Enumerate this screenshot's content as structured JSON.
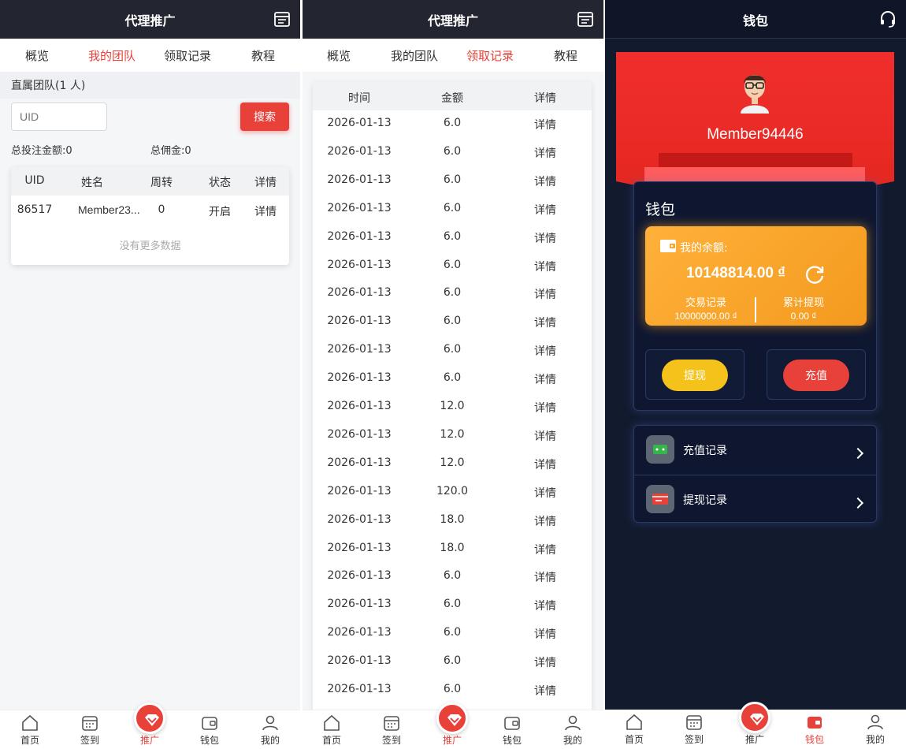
{
  "screen1": {
    "title": "代理推广",
    "tabs": [
      {
        "label": "概览",
        "active": false
      },
      {
        "label": "我的团队",
        "active": true
      },
      {
        "label": "领取记录",
        "active": false
      },
      {
        "label": "教程",
        "active": false
      }
    ],
    "team_header": "直属团队(1 人)",
    "uid_placeholder": "UID",
    "search_label": "搜索",
    "total_bet": "总投注金额:0",
    "total_commission": "总佣金:0",
    "table": {
      "headers": [
        "UID",
        "姓名",
        "周转",
        "状态",
        "详情"
      ],
      "rows": [
        [
          "86517",
          "Member23...",
          "0",
          "开启",
          "详情"
        ]
      ],
      "no_more": "没有更多数据"
    }
  },
  "screen2": {
    "title": "代理推广",
    "tabs": [
      {
        "label": "概览",
        "active": false
      },
      {
        "label": "我的团队",
        "active": false
      },
      {
        "label": "领取记录",
        "active": true
      },
      {
        "label": "教程",
        "active": false
      }
    ],
    "headers": [
      "时间",
      "金额",
      "详情"
    ],
    "rows": [
      [
        "2026-01-13",
        "6.0",
        "详情"
      ],
      [
        "2026-01-13",
        "6.0",
        "详情"
      ],
      [
        "2026-01-13",
        "6.0",
        "详情"
      ],
      [
        "2026-01-13",
        "6.0",
        "详情"
      ],
      [
        "2026-01-13",
        "6.0",
        "详情"
      ],
      [
        "2026-01-13",
        "6.0",
        "详情"
      ],
      [
        "2026-01-13",
        "6.0",
        "详情"
      ],
      [
        "2026-01-13",
        "6.0",
        "详情"
      ],
      [
        "2026-01-13",
        "6.0",
        "详情"
      ],
      [
        "2026-01-13",
        "6.0",
        "详情"
      ],
      [
        "2026-01-13",
        "12.0",
        "详情"
      ],
      [
        "2026-01-13",
        "12.0",
        "详情"
      ],
      [
        "2026-01-13",
        "12.0",
        "详情"
      ],
      [
        "2026-01-13",
        "120.0",
        "详情"
      ],
      [
        "2026-01-13",
        "18.0",
        "详情"
      ],
      [
        "2026-01-13",
        "18.0",
        "详情"
      ],
      [
        "2026-01-13",
        "6.0",
        "详情"
      ],
      [
        "2026-01-13",
        "6.0",
        "详情"
      ],
      [
        "2026-01-13",
        "6.0",
        "详情"
      ],
      [
        "2026-01-13",
        "6.0",
        "详情"
      ],
      [
        "2026-01-13",
        "6.0",
        "详情"
      ]
    ]
  },
  "screen3": {
    "title": "钱包",
    "member": "Member94446",
    "wallet_title": "钱包",
    "balance_label": "我的余额:",
    "balance_value": "10148814.00 ₫",
    "transactions_label": "交易记录",
    "transactions_value": "10000000.00 ₫",
    "withdrawn_label": "累计提现",
    "withdrawn_value": "0.00 ₫",
    "withdraw_button": "提现",
    "deposit_button": "充值",
    "menu": [
      {
        "label": "充值记录",
        "icon": "deposit-record-icon"
      },
      {
        "label": "提现记录",
        "icon": "withdraw-record-icon"
      }
    ]
  },
  "nav": {
    "items": [
      "首页",
      "签到",
      "推广",
      "钱包",
      "我的"
    ]
  },
  "colors": {
    "accent": "#e8413a",
    "topbar": "#232630",
    "wallet_bg": "#121a2e",
    "balance_card": "#ffb13a",
    "withdraw": "#f5c21b",
    "deposit": "#e8413a"
  }
}
